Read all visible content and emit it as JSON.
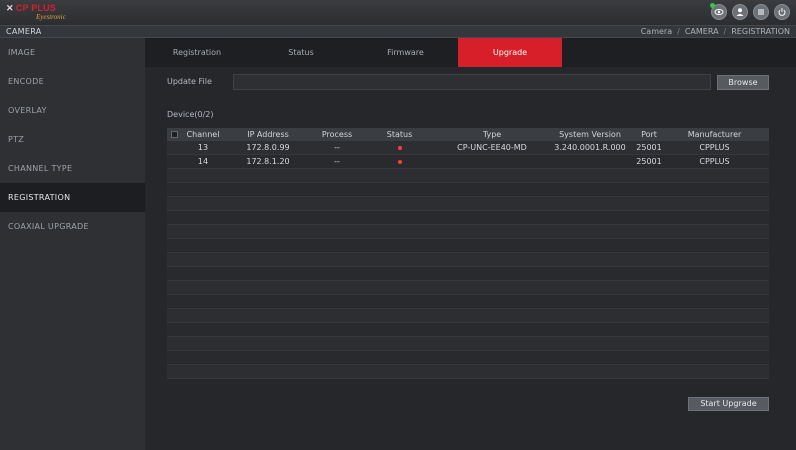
{
  "header": {
    "logo_main": "CP PLUS",
    "logo_sub": "Eyestronic",
    "icons": [
      "eye-icon",
      "user-icon",
      "menu-icon",
      "power-icon"
    ],
    "status_color": "#2ecc40"
  },
  "titlebar": {
    "title": "CAMERA",
    "breadcrumb": [
      "Camera",
      "CAMERA",
      "REGISTRATION"
    ],
    "separator": "/"
  },
  "sidebar": {
    "items": [
      {
        "label": "IMAGE"
      },
      {
        "label": "ENCODE"
      },
      {
        "label": "OVERLAY"
      },
      {
        "label": "PTZ"
      },
      {
        "label": "CHANNEL TYPE"
      },
      {
        "label": "REGISTRATION",
        "active": true
      },
      {
        "label": "COAXIAL UPGRADE"
      }
    ]
  },
  "tabs": [
    {
      "label": "Registration"
    },
    {
      "label": "Status"
    },
    {
      "label": "Firmware"
    },
    {
      "label": "Upgrade",
      "active": true
    }
  ],
  "upgrade": {
    "update_file_label": "Update File",
    "update_file_value": "",
    "browse_label": "Browse",
    "device_count": "Device(0/2)",
    "start_label": "Start Upgrade"
  },
  "table": {
    "columns": [
      "",
      "Channel",
      "IP Address",
      "Process",
      "Status",
      "Type",
      "System Version",
      "Port",
      "Manufacturer"
    ],
    "rows": [
      {
        "channel": "13",
        "ip": "172.8.0.99",
        "process": "--",
        "status": "red",
        "type": "CP-UNC-EE40-MD",
        "version": "3.240.0001.R.000",
        "port": "25001",
        "manufacturer": "CPPLUS"
      },
      {
        "channel": "14",
        "ip": "172.8.1.20",
        "process": "--",
        "status": "red",
        "type": "",
        "version": "",
        "port": "25001",
        "manufacturer": "CPPLUS"
      }
    ],
    "empty_rows": 15,
    "accent_color": "#d71f2a",
    "status_red": "#ff3b3b"
  }
}
